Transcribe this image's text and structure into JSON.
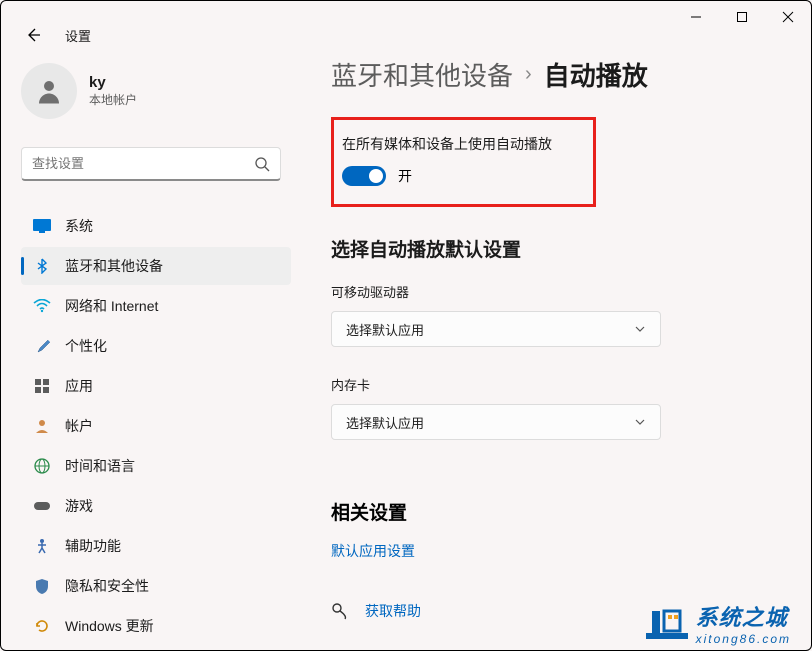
{
  "window": {
    "title": "设置"
  },
  "account": {
    "name": "ky",
    "subtitle": "本地帐户"
  },
  "search": {
    "placeholder": "查找设置"
  },
  "nav": {
    "items": [
      {
        "label": "系统"
      },
      {
        "label": "蓝牙和其他设备"
      },
      {
        "label": "网络和 Internet"
      },
      {
        "label": "个性化"
      },
      {
        "label": "应用"
      },
      {
        "label": "帐户"
      },
      {
        "label": "时间和语言"
      },
      {
        "label": "游戏"
      },
      {
        "label": "辅助功能"
      },
      {
        "label": "隐私和安全性"
      },
      {
        "label": "Windows 更新"
      }
    ],
    "selected_index": 1
  },
  "breadcrumb": {
    "parent": "蓝牙和其他设备",
    "current": "自动播放"
  },
  "toggle": {
    "label": "在所有媒体和设备上使用自动播放",
    "state": "开",
    "on": true
  },
  "defaults": {
    "heading": "选择自动播放默认设置",
    "fields": [
      {
        "label": "可移动驱动器",
        "value": "选择默认应用"
      },
      {
        "label": "内存卡",
        "value": "选择默认应用"
      }
    ]
  },
  "related": {
    "heading": "相关设置",
    "link": "默认应用设置"
  },
  "help": {
    "label": "获取帮助"
  },
  "watermark": {
    "line1": "系统之城",
    "line2": "xitong86.com"
  }
}
